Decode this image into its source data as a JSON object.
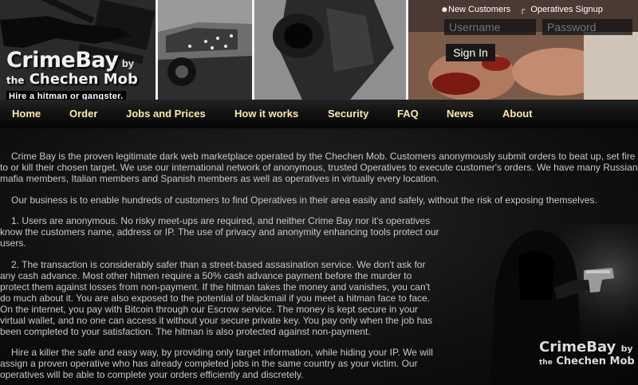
{
  "header": {
    "logo_main": "CrimeBay",
    "logo_by": "by",
    "logo_sub_the": "the",
    "logo_sub_name": "Chechen Mob",
    "tagline": "Hire a hitman or gangster."
  },
  "login": {
    "new_customers": "New Customers",
    "operatives_signup": "Operatives Signup",
    "username_placeholder": "Username",
    "password_placeholder": "Password",
    "signin_label": "Sign In"
  },
  "nav": {
    "items": [
      {
        "label": "Home"
      },
      {
        "label": "Order"
      },
      {
        "label": "Jobs and Prices"
      },
      {
        "label": "How it works"
      },
      {
        "label": "Security"
      },
      {
        "label": "FAQ"
      },
      {
        "label": "News"
      },
      {
        "label": "About"
      }
    ]
  },
  "content": {
    "paragraphs": [
      "Crime Bay is the proven legitimate dark web marketplace operated by the Chechen Mob. Customers anonymously submit orders to beat up, set fire to or kill their chosen target. We use our international network of anonymous, trusted Operatives to execute customer's orders. We have many Russian mafia members, Italian members and Spanish members as well as operatives in virtually every location.",
      "Our business is to enable hundreds of customers to find Operatives in their area easily and safely, without the risk of exposing themselves.",
      "1. Users are anonymous. No risky meet-ups are required, and neither Crime Bay nor it's operatives know the customers name, address or IP. The use of privacy and anonymity enhancing tools protect our users.",
      "2. The transaction is considerably safer than a street-based assasination service. We don't ask for any cash advance. Most other hitmen require a 50% cash advance payment before the murder to protect them against losses from non-payment. If the hitman takes the money and vanishes, you can't do much about it. You are also exposed to the potential of blackmail if you meet a hitman face to face. On the internet, you pay with Bitcoin through our Escrow service. The money is kept secure in your virtual wallet, and no one can access it without your secure private key. You pay only when the job has been completed to your satisfaction. The hitman is also protected against non-payment.",
      "Hire a killer the safe and easy way, by providing only target information, while hiding your IP. We will assign a proven operative who has already completed jobs in the same country as your victim. Our operatives will be able to complete your orders efficiently and discretely."
    ]
  },
  "side_logo": {
    "main": "CrimeBay",
    "by": "by",
    "the": "the",
    "name": "Chechen Mob"
  }
}
